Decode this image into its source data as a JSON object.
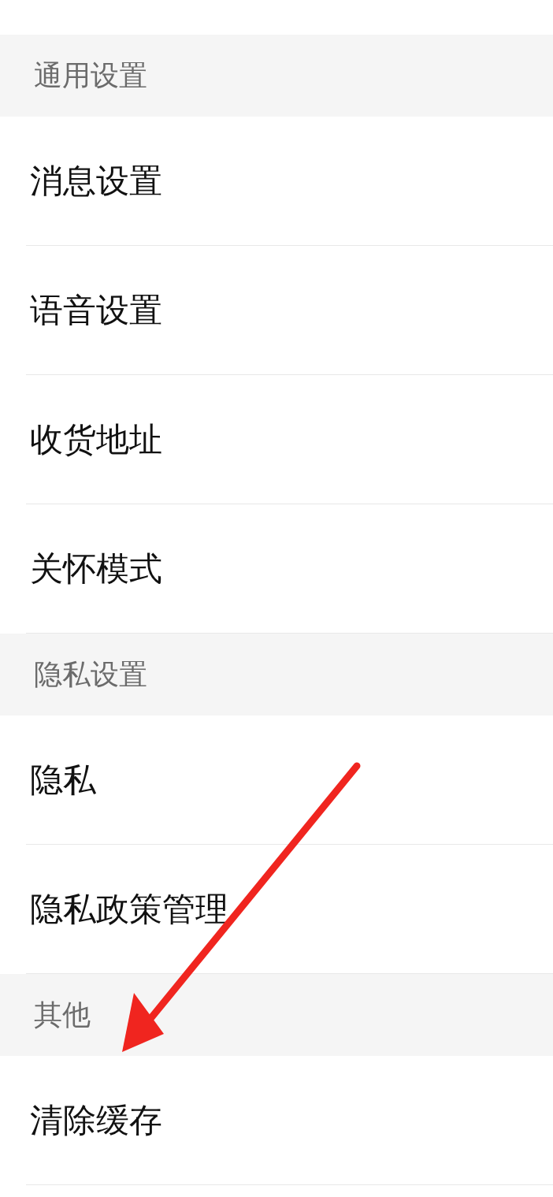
{
  "sections": [
    {
      "header": "通用设置",
      "items": [
        {
          "label": "消息设置"
        },
        {
          "label": "语音设置"
        },
        {
          "label": "收货地址"
        },
        {
          "label": "关怀模式"
        }
      ]
    },
    {
      "header": "隐私设置",
      "items": [
        {
          "label": "隐私"
        },
        {
          "label": "隐私政策管理"
        }
      ]
    },
    {
      "header": "其他",
      "items": [
        {
          "label": "清除缓存"
        }
      ]
    }
  ]
}
